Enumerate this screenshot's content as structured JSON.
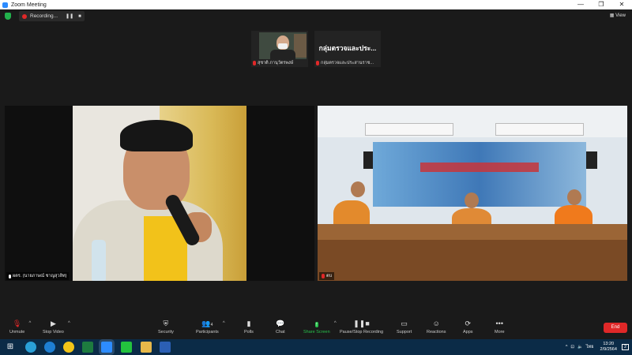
{
  "window": {
    "title": "Zoom Meeting",
    "controls": [
      "—",
      "❐",
      "✕"
    ]
  },
  "topbar": {
    "recording_label": "Recording...",
    "pause_glyph": "❚❚",
    "stop_glyph": "■",
    "view_label": "View"
  },
  "thumbnails": [
    {
      "name": "สุชาติ ภานุวัตรพงษ์"
    },
    {
      "display_name": "กลุ่มตรวจและประ...",
      "name": "กลุ่มตรวจและประสานราช..."
    }
  ],
  "main_tiles": [
    {
      "name": "ผตร. (นายภาษณ์ ชาญสุวลิท)"
    },
    {
      "name": "ตบ"
    }
  ],
  "toolbar": {
    "unmute": "Unmute",
    "stop_video": "Stop Video",
    "security": "Security",
    "participants": "Participants",
    "participants_count": "4",
    "polls": "Polls",
    "chat": "Chat",
    "share_screen": "Share Screen",
    "pause_stop_recording": "Pause/Stop Recording",
    "support": "Support",
    "reactions": "Reactions",
    "apps": "Apps",
    "more": "More",
    "end": "End"
  },
  "taskbar": {
    "language": "ไทย",
    "time": "13:20",
    "date": "2/9/2564",
    "notification_count": "2"
  },
  "colors": {
    "accent": "#2d8cff",
    "end_red": "#e02828",
    "share_green": "#27c24c",
    "taskbar": "#0b2b47"
  }
}
